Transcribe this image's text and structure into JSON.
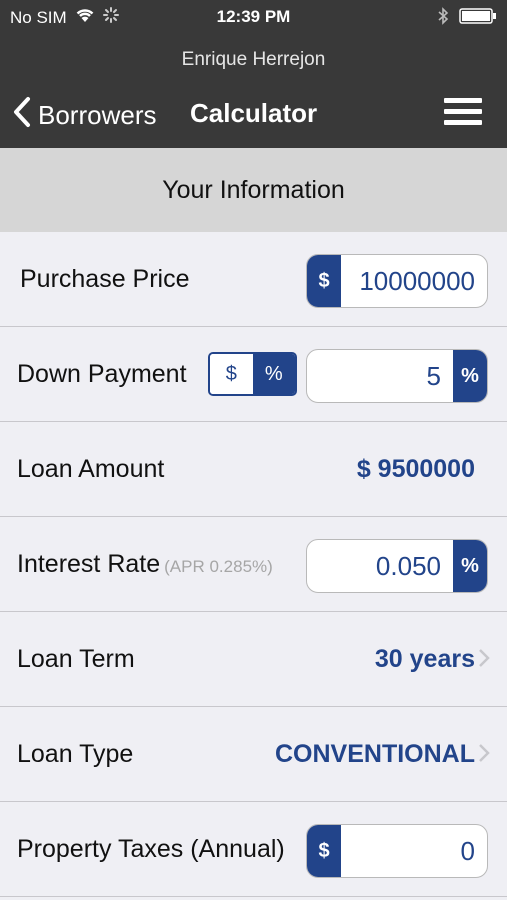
{
  "status_bar": {
    "carrier": "No SIM",
    "time": "12:39 PM"
  },
  "header": {
    "user_name": "Enrique Herrejon",
    "back_label": "Borrowers",
    "title": "Calculator"
  },
  "section": {
    "title": "Your Information"
  },
  "rows": {
    "purchase_price": {
      "label": "Purchase Price",
      "currency": "$",
      "value": "10000000"
    },
    "down_payment": {
      "label": "Down Payment",
      "toggle_dollar": "$",
      "toggle_percent": "%",
      "value": "5",
      "unit": "%"
    },
    "loan_amount": {
      "label": "Loan Amount",
      "value": "$ 9500000"
    },
    "interest_rate": {
      "label": "Interest Rate",
      "apr": "(APR 0.285%)",
      "value": "0.050",
      "unit": "%"
    },
    "loan_term": {
      "label": "Loan Term",
      "value": "30 years"
    },
    "loan_type": {
      "label": "Loan Type",
      "value": "CONVENTIONAL"
    },
    "property_taxes": {
      "label": "Property Taxes (Annual)",
      "currency": "$",
      "value": "0"
    }
  },
  "colors": {
    "header_bg": "#393939",
    "accent": "#22448a",
    "section_bg": "#d6d6d6",
    "row_bg": "#efeff4"
  }
}
